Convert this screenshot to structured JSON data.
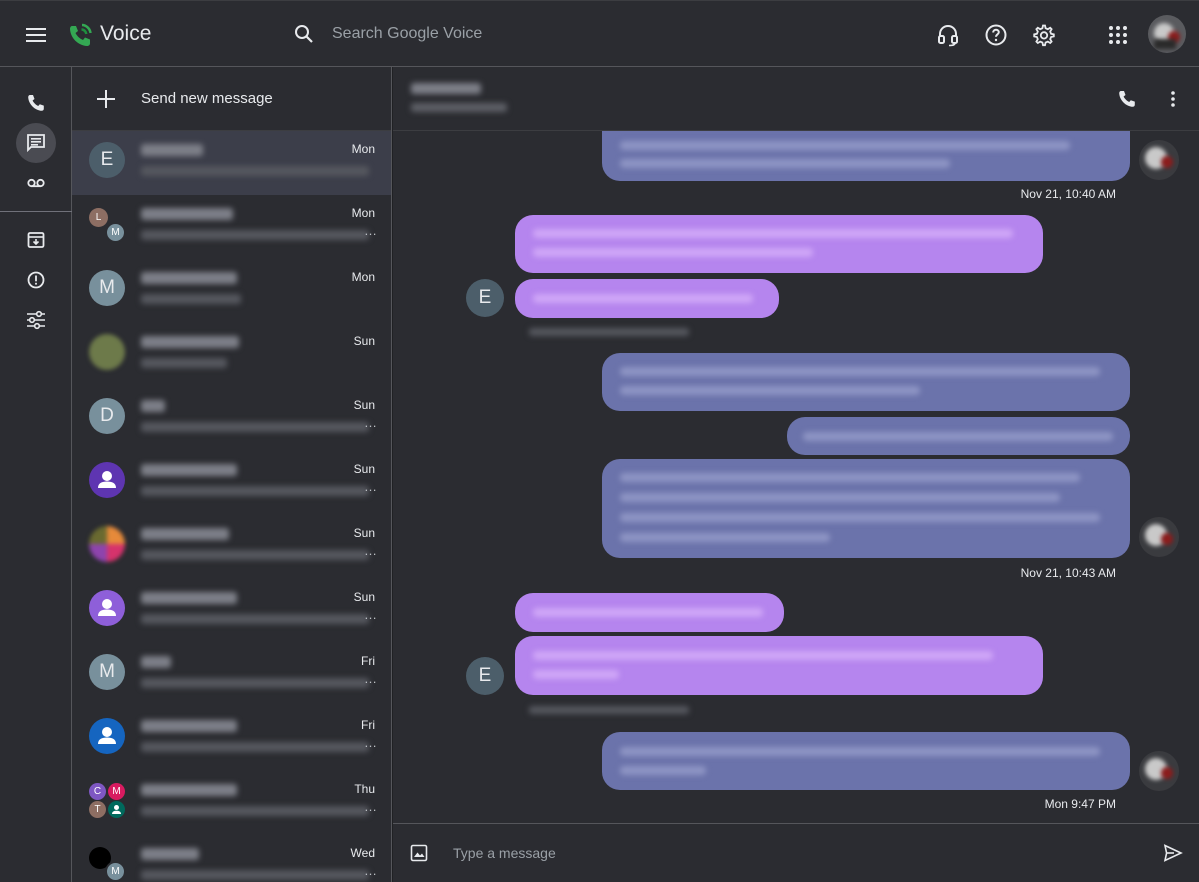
{
  "app": {
    "title": "Voice",
    "search_placeholder": "Search Google Voice"
  },
  "topbar_icons": [
    "menu-icon",
    "voice-logo-icon",
    "search-icon",
    "headset-icon",
    "help-icon",
    "settings-icon",
    "apps-grid-icon",
    "account-avatar"
  ],
  "rail": {
    "items": [
      {
        "name": "calls",
        "icon": "phone-icon",
        "active": false
      },
      {
        "name": "messages",
        "icon": "message-icon",
        "active": true
      },
      {
        "name": "voicemail",
        "icon": "voicemail-icon",
        "active": false
      },
      {
        "name": "archive",
        "icon": "archive-icon",
        "active": false
      },
      {
        "name": "spam",
        "icon": "spam-icon",
        "active": false
      },
      {
        "name": "settings",
        "icon": "tune-icon",
        "active": false
      }
    ]
  },
  "list": {
    "send_new_label": "Send new message",
    "conversations": [
      {
        "avatar": "E",
        "day": "Mon",
        "selected": true
      },
      {
        "avatar": "L/M",
        "day": "Mon"
      },
      {
        "avatar": "M",
        "day": "Mon"
      },
      {
        "avatar": "photo",
        "day": "Sun"
      },
      {
        "avatar": "D",
        "day": "Sun"
      },
      {
        "avatar": "person",
        "day": "Sun"
      },
      {
        "avatar": "group",
        "day": "Sun"
      },
      {
        "avatar": "person",
        "day": "Sun"
      },
      {
        "avatar": "M",
        "day": "Fri"
      },
      {
        "avatar": "person",
        "day": "Fri"
      },
      {
        "avatar": "C/M/T",
        "day": "Thu"
      },
      {
        "avatar": "dark/M",
        "day": "Wed"
      }
    ],
    "letters": {
      "e": "E",
      "l": "L",
      "m": "M",
      "d": "D",
      "c": "C",
      "t": "T"
    }
  },
  "chat": {
    "contact_avatar": "E",
    "timestamps": {
      "t1": "Nov 21, 10:40 AM",
      "t2": "Nov 21, 10:43 AM",
      "t3": "Mon 9:47 PM"
    },
    "composer_placeholder": "Type a message"
  },
  "colors": {
    "background": "#2b2c31",
    "outgoing_bubble": "#6b73ab",
    "incoming_bubble": "#b585ee",
    "selected_row": "#3c3e4a"
  }
}
